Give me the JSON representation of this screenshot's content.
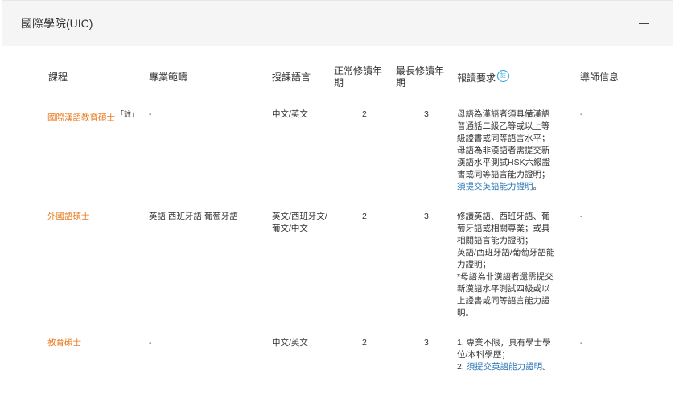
{
  "panel": {
    "title": "國際學院(UIC)",
    "collapse_label": "—"
  },
  "table": {
    "headers": {
      "course": "課程",
      "scope": "專業範疇",
      "language": "授課語言",
      "normal_years_1": "正常修讀年",
      "normal_years_2": "期",
      "max_years_1": "最長修讀年",
      "max_years_2": "期",
      "requirements": "報讀要求",
      "req_note_icon": "註",
      "tutor": "導師信息"
    },
    "rows": [
      {
        "course": "國際漢語教育碩士",
        "course_note": "「註」",
        "scope": "-",
        "language": "中文/英文",
        "normal": "2",
        "max": "3",
        "req": [
          "母語為漢語者須具備漢語",
          "普通話二級乙等或以上等",
          "級證書或同等語言水平；",
          "母語為非漢語者需提交新",
          "漢語水平測試HSK六級證",
          "書或同等語言能力證明；"
        ],
        "req_link": "須提交英語能力證明",
        "req_link_tail": "。",
        "tutor": "-"
      },
      {
        "course": "外國語碩士",
        "scope": "英語 西班牙語 葡萄牙語",
        "language_1": "英文/西班牙文/",
        "language_2": "葡文/中文",
        "normal": "2",
        "max": "3",
        "req": [
          "修讀英語、西班牙語、葡",
          "萄牙語或相關專業；或具",
          "相關語言能力證明；",
          "英語/西班牙語/葡萄牙語能",
          "力證明；",
          "*母語為非漢語者還需提交",
          "新漢語水平測試四級或以",
          "上證書或同等語言能力證",
          "明。"
        ],
        "tutor": "-"
      },
      {
        "course": "教育碩士",
        "scope": "-",
        "language": "中文/英文",
        "normal": "2",
        "max": "3",
        "req": [
          "1. 專業不限，具有學士學",
          "位/本科學歷；"
        ],
        "req_link_prefix": "2. ",
        "req_link": "須提交英語能力證明",
        "req_link_tail": "。",
        "tutor": "-"
      }
    ]
  },
  "colors": {
    "accent": "#e8791e",
    "link": "#1f6fb2",
    "header_bg": "#f5f5f5"
  }
}
